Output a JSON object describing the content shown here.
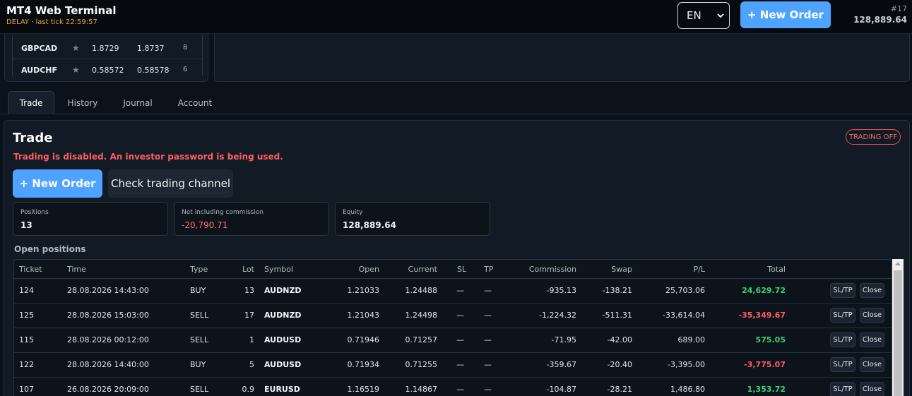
{
  "header": {
    "title": "MT4 Web Terminal",
    "status": "DELAY · last tick 22:59:57",
    "language": "EN",
    "new_order_label": "+ New Order",
    "account_id": "#17",
    "balance": "128,889.64"
  },
  "quotes": [
    {
      "symbol": "GBPCAD",
      "bid": "1.8729",
      "ask": "1.8737",
      "spread": "8"
    },
    {
      "symbol": "AUDCHF",
      "bid": "0.58572",
      "ask": "0.58578",
      "spread": "6"
    }
  ],
  "tabs": [
    {
      "label": "Trade",
      "active": true
    },
    {
      "label": "History",
      "active": false
    },
    {
      "label": "Journal",
      "active": false
    },
    {
      "label": "Account",
      "active": false
    }
  ],
  "trade": {
    "title": "Trade",
    "badge": "TRADING OFF",
    "warning": "Trading is disabled. An investor password is being used.",
    "new_order_label": "+ New Order",
    "check_channel_label": "Check trading channel",
    "stats": [
      {
        "label": "Positions",
        "value": "13"
      },
      {
        "label": "Net including commission",
        "value": "-20,790.71"
      },
      {
        "label": "Equity",
        "value": "128,889.64"
      }
    ],
    "open_positions_label": "Open positions"
  },
  "table": {
    "columns": [
      "Ticket",
      "Time",
      "Type",
      "Lot",
      "Symbol",
      "Open",
      "Current",
      "SL",
      "TP",
      "Commission",
      "Swap",
      "P/L",
      "Total"
    ],
    "rows": [
      {
        "ticket": "124",
        "time": "28.08.2026 14:43:00",
        "type": "BUY",
        "lot": "13",
        "symbol": "AUDNZD",
        "open": "1.21033",
        "current": "1.24488",
        "sl": "—",
        "tp": "—",
        "commission": "-935.13",
        "swap": "-138.21",
        "pl": "25,703.06",
        "total": "24,629.72",
        "sltp": "SL/TP",
        "close": "Close"
      },
      {
        "ticket": "125",
        "time": "28.08.2026 15:03:00",
        "type": "SELL",
        "lot": "17",
        "symbol": "AUDNZD",
        "open": "1.21043",
        "current": "1.24498",
        "sl": "—",
        "tp": "—",
        "commission": "-1,224.32",
        "swap": "-511.31",
        "pl": "-33,614.04",
        "total": "-35,349.67",
        "sltp": "SL/TP",
        "close": "Close"
      },
      {
        "ticket": "115",
        "time": "28.08.2026 00:12:00",
        "type": "SELL",
        "lot": "1",
        "symbol": "AUDUSD",
        "open": "0.71946",
        "current": "0.71257",
        "sl": "—",
        "tp": "—",
        "commission": "-71.95",
        "swap": "-42.00",
        "pl": "689.00",
        "total": "575.05",
        "sltp": "SL/TP",
        "close": "Close"
      },
      {
        "ticket": "122",
        "time": "28.08.2026 14:40:00",
        "type": "BUY",
        "lot": "5",
        "symbol": "AUDUSD",
        "open": "0.71934",
        "current": "0.71255",
        "sl": "—",
        "tp": "—",
        "commission": "-359.67",
        "swap": "-20.40",
        "pl": "-3,395.00",
        "total": "-3,775.07",
        "sltp": "SL/TP",
        "close": "Close"
      },
      {
        "ticket": "107",
        "time": "26.08.2026 20:09:00",
        "type": "SELL",
        "lot": "0.9",
        "symbol": "EURUSD",
        "open": "1.16519",
        "current": "1.14867",
        "sl": "—",
        "tp": "—",
        "commission": "-104.87",
        "swap": "-28.21",
        "pl": "1,486.80",
        "total": "1,353.72",
        "sltp": "SL/TP",
        "close": "Close"
      }
    ]
  },
  "colors": {
    "accent": "#4da3ff",
    "positive": "#3ecf72",
    "negative": "#ff5d5d",
    "delay_status": "#e6a23c"
  }
}
